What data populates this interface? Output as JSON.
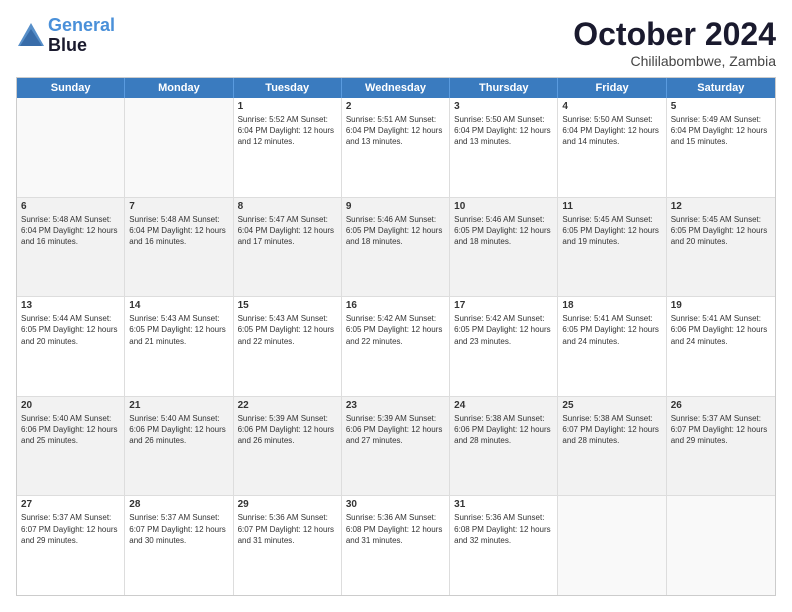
{
  "header": {
    "logo": {
      "line1": "General",
      "line2": "Blue"
    },
    "title": "October 2024",
    "subtitle": "Chililabombwe, Zambia"
  },
  "weekdays": [
    "Sunday",
    "Monday",
    "Tuesday",
    "Wednesday",
    "Thursday",
    "Friday",
    "Saturday"
  ],
  "rows": [
    [
      {
        "day": "",
        "text": "",
        "empty": true
      },
      {
        "day": "",
        "text": "",
        "empty": true
      },
      {
        "day": "1",
        "text": "Sunrise: 5:52 AM\nSunset: 6:04 PM\nDaylight: 12 hours and 12 minutes."
      },
      {
        "day": "2",
        "text": "Sunrise: 5:51 AM\nSunset: 6:04 PM\nDaylight: 12 hours and 13 minutes."
      },
      {
        "day": "3",
        "text": "Sunrise: 5:50 AM\nSunset: 6:04 PM\nDaylight: 12 hours and 13 minutes."
      },
      {
        "day": "4",
        "text": "Sunrise: 5:50 AM\nSunset: 6:04 PM\nDaylight: 12 hours and 14 minutes."
      },
      {
        "day": "5",
        "text": "Sunrise: 5:49 AM\nSunset: 6:04 PM\nDaylight: 12 hours and 15 minutes."
      }
    ],
    [
      {
        "day": "6",
        "text": "Sunrise: 5:48 AM\nSunset: 6:04 PM\nDaylight: 12 hours and 16 minutes.",
        "shaded": true
      },
      {
        "day": "7",
        "text": "Sunrise: 5:48 AM\nSunset: 6:04 PM\nDaylight: 12 hours and 16 minutes.",
        "shaded": true
      },
      {
        "day": "8",
        "text": "Sunrise: 5:47 AM\nSunset: 6:04 PM\nDaylight: 12 hours and 17 minutes.",
        "shaded": true
      },
      {
        "day": "9",
        "text": "Sunrise: 5:46 AM\nSunset: 6:05 PM\nDaylight: 12 hours and 18 minutes.",
        "shaded": true
      },
      {
        "day": "10",
        "text": "Sunrise: 5:46 AM\nSunset: 6:05 PM\nDaylight: 12 hours and 18 minutes.",
        "shaded": true
      },
      {
        "day": "11",
        "text": "Sunrise: 5:45 AM\nSunset: 6:05 PM\nDaylight: 12 hours and 19 minutes.",
        "shaded": true
      },
      {
        "day": "12",
        "text": "Sunrise: 5:45 AM\nSunset: 6:05 PM\nDaylight: 12 hours and 20 minutes.",
        "shaded": true
      }
    ],
    [
      {
        "day": "13",
        "text": "Sunrise: 5:44 AM\nSunset: 6:05 PM\nDaylight: 12 hours and 20 minutes."
      },
      {
        "day": "14",
        "text": "Sunrise: 5:43 AM\nSunset: 6:05 PM\nDaylight: 12 hours and 21 minutes."
      },
      {
        "day": "15",
        "text": "Sunrise: 5:43 AM\nSunset: 6:05 PM\nDaylight: 12 hours and 22 minutes."
      },
      {
        "day": "16",
        "text": "Sunrise: 5:42 AM\nSunset: 6:05 PM\nDaylight: 12 hours and 22 minutes."
      },
      {
        "day": "17",
        "text": "Sunrise: 5:42 AM\nSunset: 6:05 PM\nDaylight: 12 hours and 23 minutes."
      },
      {
        "day": "18",
        "text": "Sunrise: 5:41 AM\nSunset: 6:05 PM\nDaylight: 12 hours and 24 minutes."
      },
      {
        "day": "19",
        "text": "Sunrise: 5:41 AM\nSunset: 6:06 PM\nDaylight: 12 hours and 24 minutes."
      }
    ],
    [
      {
        "day": "20",
        "text": "Sunrise: 5:40 AM\nSunset: 6:06 PM\nDaylight: 12 hours and 25 minutes.",
        "shaded": true
      },
      {
        "day": "21",
        "text": "Sunrise: 5:40 AM\nSunset: 6:06 PM\nDaylight: 12 hours and 26 minutes.",
        "shaded": true
      },
      {
        "day": "22",
        "text": "Sunrise: 5:39 AM\nSunset: 6:06 PM\nDaylight: 12 hours and 26 minutes.",
        "shaded": true
      },
      {
        "day": "23",
        "text": "Sunrise: 5:39 AM\nSunset: 6:06 PM\nDaylight: 12 hours and 27 minutes.",
        "shaded": true
      },
      {
        "day": "24",
        "text": "Sunrise: 5:38 AM\nSunset: 6:06 PM\nDaylight: 12 hours and 28 minutes.",
        "shaded": true
      },
      {
        "day": "25",
        "text": "Sunrise: 5:38 AM\nSunset: 6:07 PM\nDaylight: 12 hours and 28 minutes.",
        "shaded": true
      },
      {
        "day": "26",
        "text": "Sunrise: 5:37 AM\nSunset: 6:07 PM\nDaylight: 12 hours and 29 minutes.",
        "shaded": true
      }
    ],
    [
      {
        "day": "27",
        "text": "Sunrise: 5:37 AM\nSunset: 6:07 PM\nDaylight: 12 hours and 29 minutes."
      },
      {
        "day": "28",
        "text": "Sunrise: 5:37 AM\nSunset: 6:07 PM\nDaylight: 12 hours and 30 minutes."
      },
      {
        "day": "29",
        "text": "Sunrise: 5:36 AM\nSunset: 6:07 PM\nDaylight: 12 hours and 31 minutes."
      },
      {
        "day": "30",
        "text": "Sunrise: 5:36 AM\nSunset: 6:08 PM\nDaylight: 12 hours and 31 minutes."
      },
      {
        "day": "31",
        "text": "Sunrise: 5:36 AM\nSunset: 6:08 PM\nDaylight: 12 hours and 32 minutes."
      },
      {
        "day": "",
        "text": "",
        "empty": true
      },
      {
        "day": "",
        "text": "",
        "empty": true
      }
    ]
  ]
}
